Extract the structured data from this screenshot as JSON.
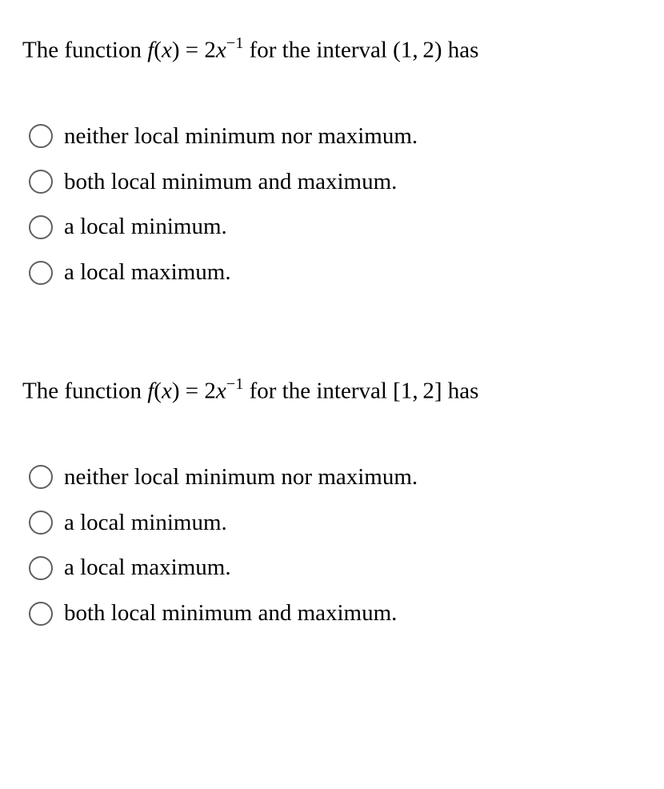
{
  "questions": [
    {
      "prompt_pre": "The function ",
      "f": "f",
      "x": "x",
      "eq": " = 2",
      "xbase": "x",
      "exp": "−1",
      "prompt_mid": " for the interval (1, 2) has",
      "options": [
        "neither local minimum nor maximum.",
        "both local minimum and maximum.",
        "a local minimum.",
        "a local maximum."
      ]
    },
    {
      "prompt_pre": "The function ",
      "f": "f",
      "x": "x",
      "eq": " = 2",
      "xbase": "x",
      "exp": "−1",
      "prompt_mid": " for the interval [1, 2] has",
      "options": [
        "neither local minimum nor maximum.",
        "a local minimum.",
        "a local maximum.",
        "both local minimum and maximum."
      ]
    }
  ]
}
